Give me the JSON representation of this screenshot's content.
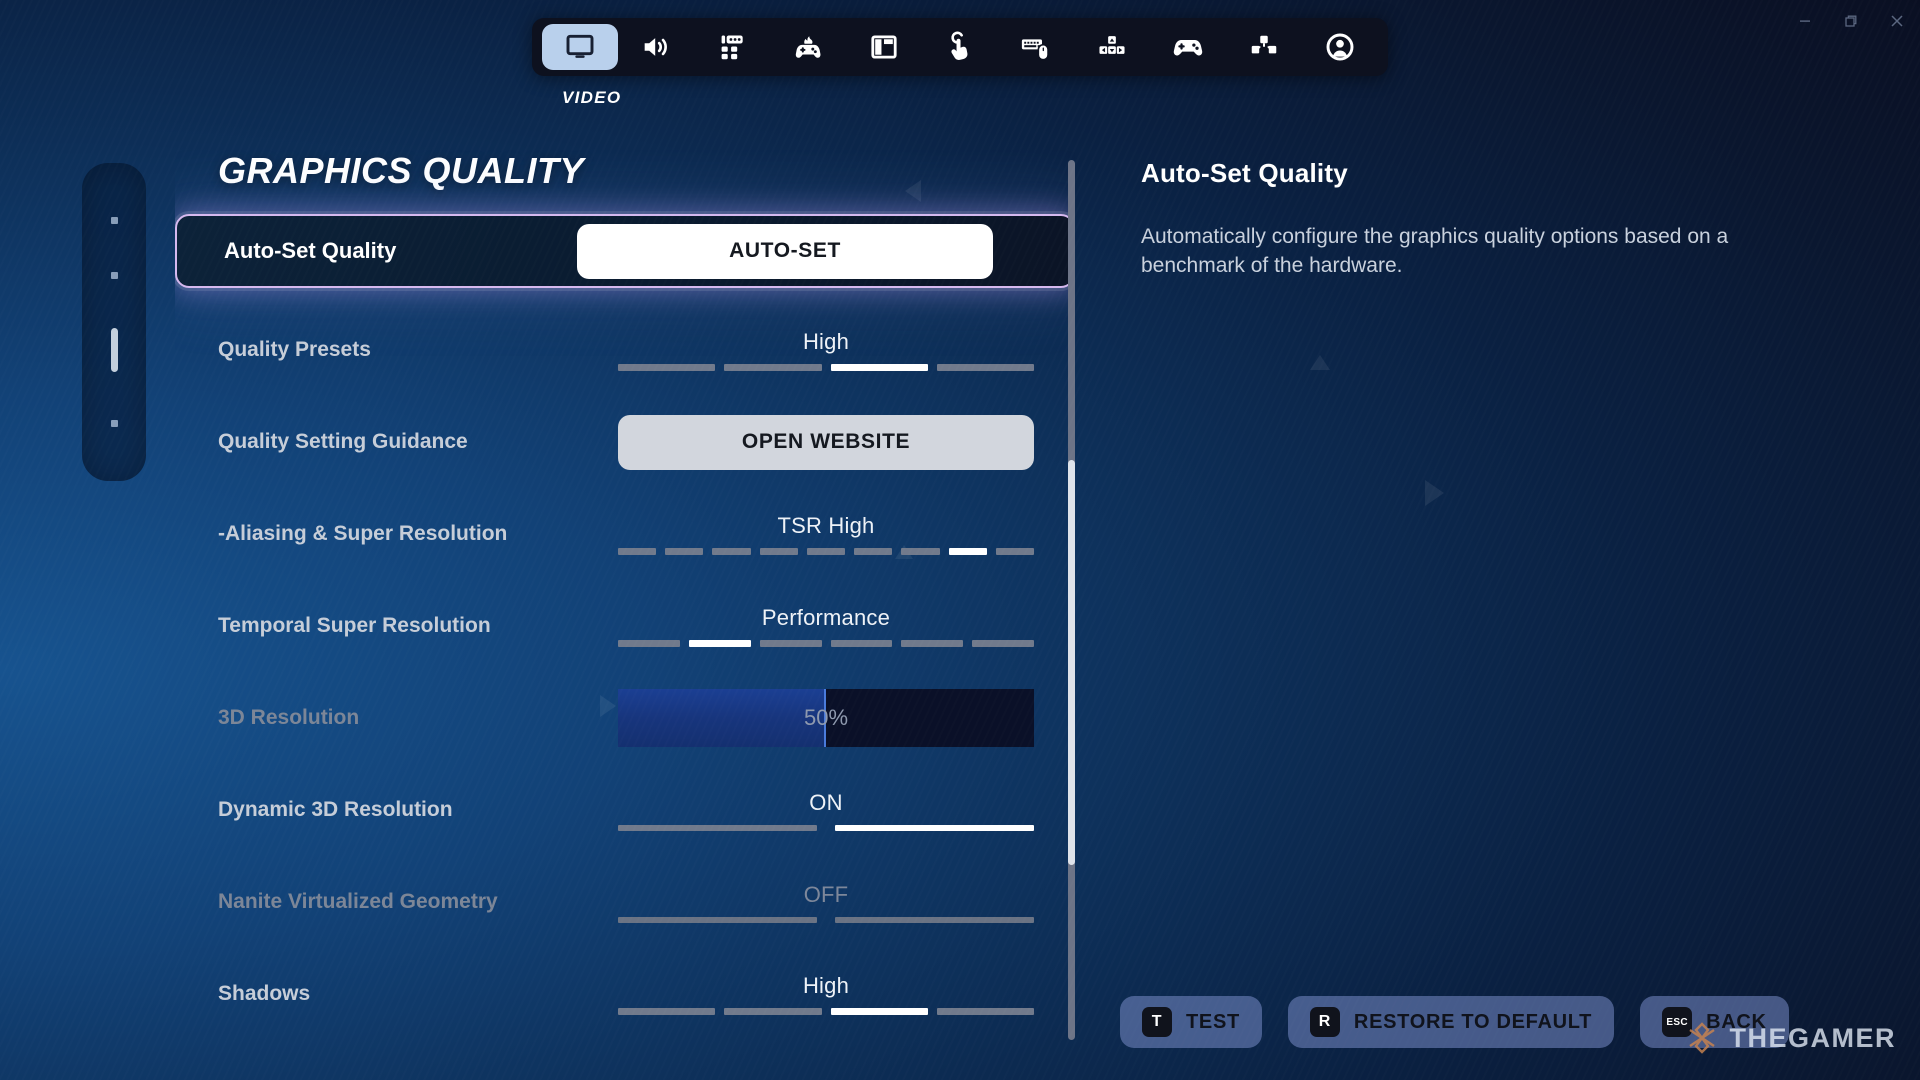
{
  "window": {
    "controls": [
      {
        "name": "minimize",
        "glyph": "minimize-icon"
      },
      {
        "name": "maximize",
        "glyph": "maximize-icon"
      },
      {
        "name": "close",
        "glyph": "close-icon"
      }
    ]
  },
  "tabs": {
    "active_label": "VIDEO",
    "items": [
      {
        "icon": "monitor-icon",
        "name": "video",
        "active": true
      },
      {
        "icon": "speaker-icon",
        "name": "audio",
        "active": false
      },
      {
        "icon": "accessibility-icon",
        "name": "accessibility",
        "active": false
      },
      {
        "icon": "gamepad-settings-icon",
        "name": "game",
        "active": false
      },
      {
        "icon": "hud-layout-icon",
        "name": "hud",
        "active": false
      },
      {
        "icon": "touch-pointer-icon",
        "name": "touch",
        "active": false
      },
      {
        "icon": "keyboard-mouse-icon",
        "name": "keyboard-mouse",
        "active": false
      },
      {
        "icon": "dpad-keys-icon",
        "name": "controls",
        "active": false
      },
      {
        "icon": "gamepad-icon",
        "name": "controller",
        "active": false
      },
      {
        "icon": "brightness-layout-icon",
        "name": "interface",
        "active": false
      },
      {
        "icon": "account-icon",
        "name": "account",
        "active": false
      }
    ]
  },
  "section_rail": {
    "dots": [
      {
        "active": false
      },
      {
        "active": false
      },
      {
        "active": true
      },
      {
        "active": false
      }
    ]
  },
  "settings": {
    "title": "GRAPHICS QUALITY",
    "rows": [
      {
        "label": "Auto-Set Quality",
        "control": "button",
        "button_label": "AUTO-SET",
        "button_style": "white",
        "focused": true,
        "dim": false
      },
      {
        "label": "Quality Presets",
        "control": "segments",
        "value": "High",
        "segments": 4,
        "selected": 3,
        "focused": false,
        "dim": false
      },
      {
        "label": "Quality Setting Guidance",
        "control": "button",
        "button_label": "OPEN WEBSITE",
        "button_style": "grey",
        "focused": false,
        "dim": false
      },
      {
        "label": "-Aliasing & Super Resolution",
        "control": "segments",
        "value": "TSR High",
        "segments": 9,
        "selected": 8,
        "focused": false,
        "dim": false
      },
      {
        "label": "Temporal Super Resolution",
        "control": "segments",
        "value": "Performance",
        "segments": 6,
        "selected": 2,
        "focused": false,
        "dim": false
      },
      {
        "label": "3D Resolution",
        "control": "progress",
        "value": "50%",
        "percent": 50,
        "focused": false,
        "dim": true
      },
      {
        "label": "Dynamic 3D Resolution",
        "control": "toggle",
        "value": "ON",
        "segments": 2,
        "selected": 2,
        "focused": false,
        "dim": false
      },
      {
        "label": "Nanite Virtualized Geometry",
        "control": "toggle",
        "value": "OFF",
        "segments": 2,
        "selected": 0,
        "focused": false,
        "dim": true
      },
      {
        "label": "Shadows",
        "control": "segments",
        "value": "High",
        "segments": 4,
        "selected": 3,
        "focused": false,
        "dim": false
      }
    ]
  },
  "info": {
    "title": "Auto-Set Quality",
    "description": "Automatically configure the graphics quality options based on a benchmark of the hardware."
  },
  "actions": [
    {
      "key": "T",
      "label": "TEST",
      "name": "test-button"
    },
    {
      "key": "R",
      "label": "RESTORE TO DEFAULT",
      "name": "restore-to-default-button"
    },
    {
      "key": "ESC",
      "label": "BACK",
      "name": "back-button"
    }
  ],
  "watermark": {
    "text": "THEGAMER"
  },
  "colors": {
    "accent_focus": "#d6b9ef",
    "progress_fill": "#1b3f93",
    "tab_active_bg": "#b9d0ec",
    "action_button": "#768ac4"
  }
}
